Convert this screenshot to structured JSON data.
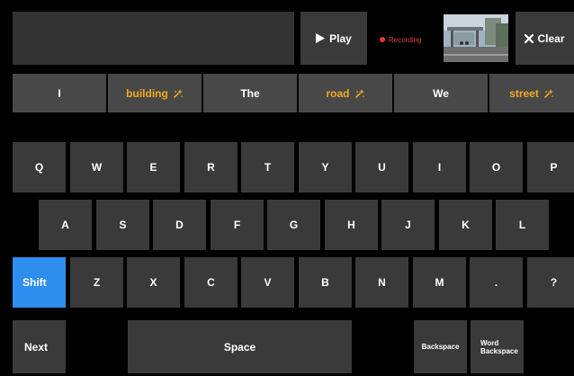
{
  "top": {
    "play_label": "Play",
    "recording_label": "Recording",
    "clear_label": "Clear",
    "text_value": ""
  },
  "suggestions": [
    {
      "label": "I",
      "predicted": false
    },
    {
      "label": "building",
      "predicted": true
    },
    {
      "label": "The",
      "predicted": false
    },
    {
      "label": "road",
      "predicted": true
    },
    {
      "label": "We",
      "predicted": false
    },
    {
      "label": "street",
      "predicted": true
    }
  ],
  "keys": {
    "row1": [
      "Q",
      "W",
      "E",
      "R",
      "T",
      "Y",
      "U",
      "I",
      "O",
      "P"
    ],
    "row2": [
      "A",
      "S",
      "D",
      "F",
      "G",
      "H",
      "J",
      "K",
      "L"
    ],
    "row3": [
      "Shift",
      "Z",
      "X",
      "C",
      "V",
      "B",
      "N",
      "M",
      ".",
      "?"
    ],
    "next": "Next",
    "space": "Space",
    "backspace": "Backspace",
    "word_backspace_1": "Word",
    "word_backspace_2": "Backspace"
  },
  "colors": {
    "accent_shift": "#2e8ef0",
    "prediction": "#f4a91c",
    "recording": "#e23b3b"
  },
  "icons": {
    "play": "play-icon",
    "close": "close-icon",
    "sparkle": "sparkle-icon",
    "record": "record-dot-icon"
  }
}
